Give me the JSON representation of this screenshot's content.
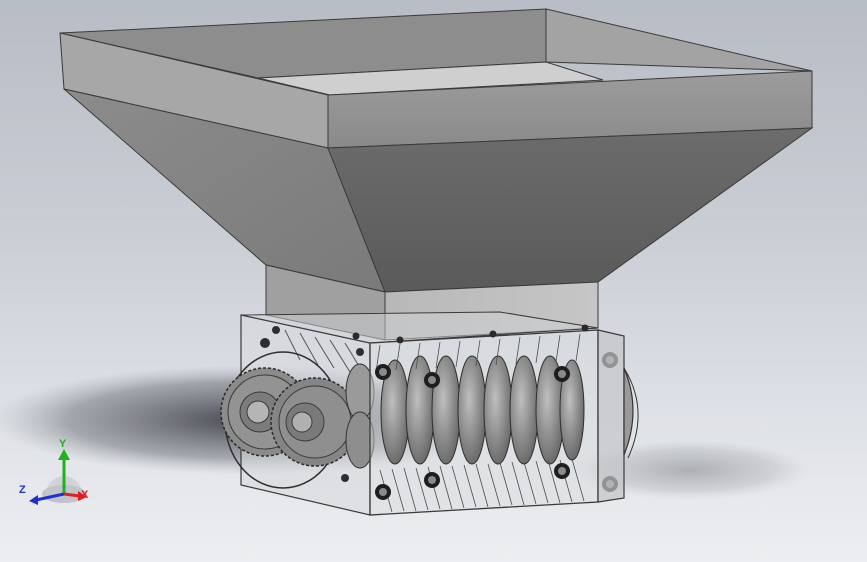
{
  "viewport": {
    "model": "shredder-assembly",
    "colors": {
      "hopper_light": "#a9a9a9",
      "hopper_mid": "#8e8e8e",
      "hopper_dark": "#6a6a6a",
      "gear": "#8a8a8a",
      "frame_line": "#3a3a3a",
      "axis_x": "#e02020",
      "axis_y": "#20b020",
      "axis_z": "#2030d0"
    }
  },
  "triad": {
    "x_label": "X",
    "y_label": "Y",
    "z_label": "Z"
  }
}
